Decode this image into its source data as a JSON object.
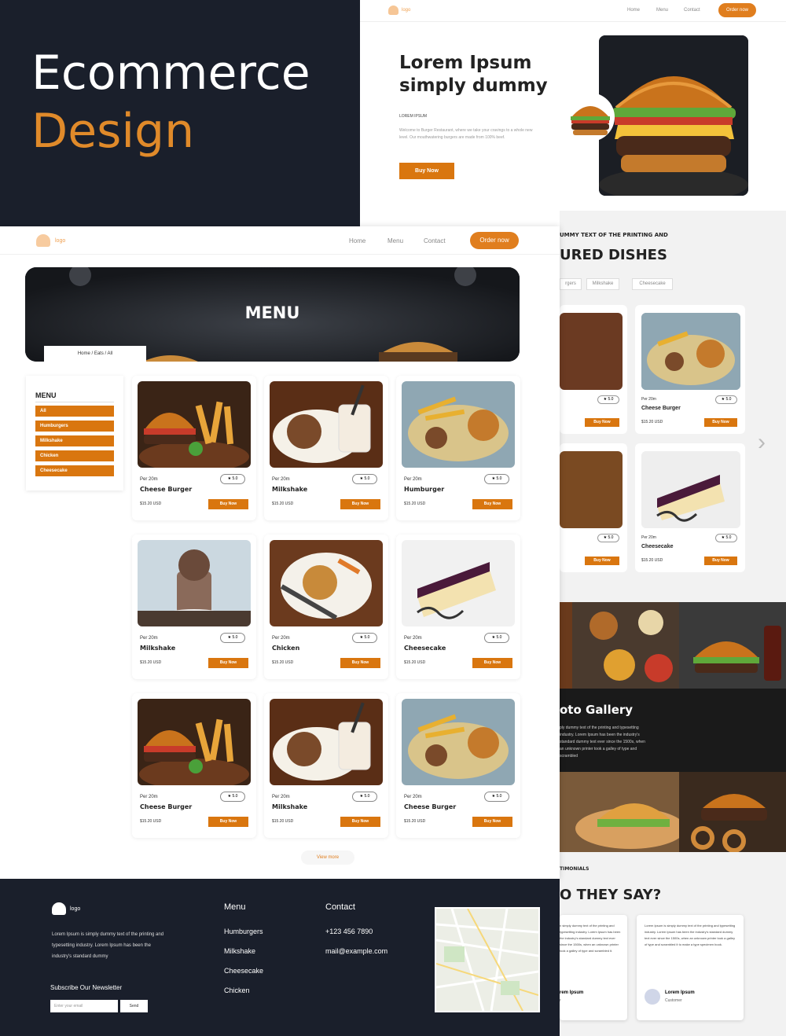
{
  "banner": {
    "line1": "Ecommerce",
    "line2": "Design"
  },
  "hero": {
    "logo": "logo",
    "nav": [
      "Home",
      "Menu",
      "Contact"
    ],
    "order_btn": "Order now",
    "title_line1": "Lorem Ipsum",
    "title_line2": "simply dummy",
    "small_heading": "LOREM IPSUM",
    "body": "Welcome to Burger Restaurant, where we take your cravings to a whole new level. Our mouthwatering burgers are made from 100% beef.",
    "buy_btn": "Buy Now"
  },
  "featured": {
    "kicker": "UMMY TEXT OF THE PRINTING AND",
    "title": "URED DISHES",
    "tabs": [
      "rgers",
      "Milkshake",
      "Cheesecake"
    ],
    "cards": [
      {
        "name": "",
        "price": "",
        "rating": "5.0",
        "buy": "Buy Now"
      },
      {
        "name": "Cheese Burger",
        "time": "Per 20m",
        "price": "$15.20 USD",
        "rating": "5.0",
        "buy": "Buy Now"
      },
      {
        "name": "",
        "price": "",
        "rating": "5.0",
        "buy": "Buy Now"
      },
      {
        "name": "Cheesecake",
        "time": "Per 20m",
        "price": "$15.20 USD",
        "rating": "5.0",
        "buy": "Buy Now"
      }
    ],
    "arrow": "›"
  },
  "gallery": {
    "title": "oto Gallery",
    "body": "ply dummy text of the printing and typesetting industry. Lorem Ipsum has been the industry's standard dummy text ever since the 1500s, when an unknown printer took a galley of type and scrambled"
  },
  "testimonials": {
    "kicker": "TIMONIALS",
    "title": "O THEY SAY?",
    "cards": [
      {
        "text": "n simply dummy text of the printing and typesetting industry. Lorem Ipsum has been the industry's standard dummy text ever since the 1500s, when an unknown printer took a galley of type and scrambled it.",
        "name": "rem Ipsum",
        "role": "r"
      },
      {
        "text": "Lorem Ipsum is simply dummy text of the printing and typesetting industry. Lorem Ipsum has been the industry's standard dummy text ever since the 1500s, when an unknown printer took a galley of type and scrambled it to make a type specimen book.",
        "name": "Lorem Ipsum",
        "role": "Customer"
      }
    ]
  },
  "menu_page": {
    "logo": "logo",
    "nav": [
      "Home",
      "Menu",
      "Contact"
    ],
    "order_btn": "Order now",
    "banner_title": "MENU",
    "breadcrumb": "Home / Eats / All",
    "sidebar_title": "MENU",
    "categories": [
      "All",
      "Humburgers",
      "Milkshake",
      "Chicken",
      "Cheesecake"
    ],
    "items": [
      {
        "time": "Per 20m",
        "name": "Cheese Burger",
        "price": "$15.20 USD",
        "rating": "5.0",
        "buy": "Buy Now",
        "img": "burger"
      },
      {
        "time": "Per 20m",
        "name": "Milkshake",
        "price": "$15.20 USD",
        "rating": "5.0",
        "buy": "Buy Now",
        "img": "shake"
      },
      {
        "time": "Per 20m",
        "name": "Humburger",
        "price": "$15.20 USD",
        "rating": "5.0",
        "buy": "Buy Now",
        "img": "platter"
      },
      {
        "time": "Per 20m",
        "name": "Milkshake",
        "price": "$15.20 USD",
        "rating": "5.0",
        "buy": "Buy Now",
        "img": "freakshake"
      },
      {
        "time": "Per 20m",
        "name": "Chicken",
        "price": "$15.20 USD",
        "rating": "5.0",
        "buy": "Buy Now",
        "img": "chicken"
      },
      {
        "time": "Per 20m",
        "name": "Cheesecake",
        "price": "$15.20 USD",
        "rating": "5.0",
        "buy": "Buy Now",
        "img": "cake"
      },
      {
        "time": "Per 20m",
        "name": "Cheese Burger",
        "price": "$15.20 USD",
        "rating": "5.0",
        "buy": "Buy Now",
        "img": "burger"
      },
      {
        "time": "Per 20m",
        "name": "Milkshake",
        "price": "$15.20 USD",
        "rating": "5.0",
        "buy": "Buy Now",
        "img": "shake"
      },
      {
        "time": "Per 20m",
        "name": "Cheese Burger",
        "price": "$15.20 USD",
        "rating": "5.0",
        "buy": "Buy Now",
        "img": "platter"
      }
    ],
    "view_more": "View more"
  },
  "footer": {
    "logo": "logo",
    "about": "Lorem Ipsum is simply dummy text of the printing and typesetting industry. Lorem Ipsum has been the industry's standard dummy",
    "newsletter": "Subscribe Our Newsletter",
    "email_placeholder": "Enter your email",
    "send": "Send",
    "menu_head": "Menu",
    "menu_links": [
      "Humburgers",
      "Milkshake",
      "Cheesecake",
      "Chicken"
    ],
    "contact_head": "Contact",
    "phone": "+123 456 7890",
    "email": "mail@example.com"
  },
  "colors": {
    "accent": "#e07e1e",
    "dark": "#1a1f2b"
  }
}
